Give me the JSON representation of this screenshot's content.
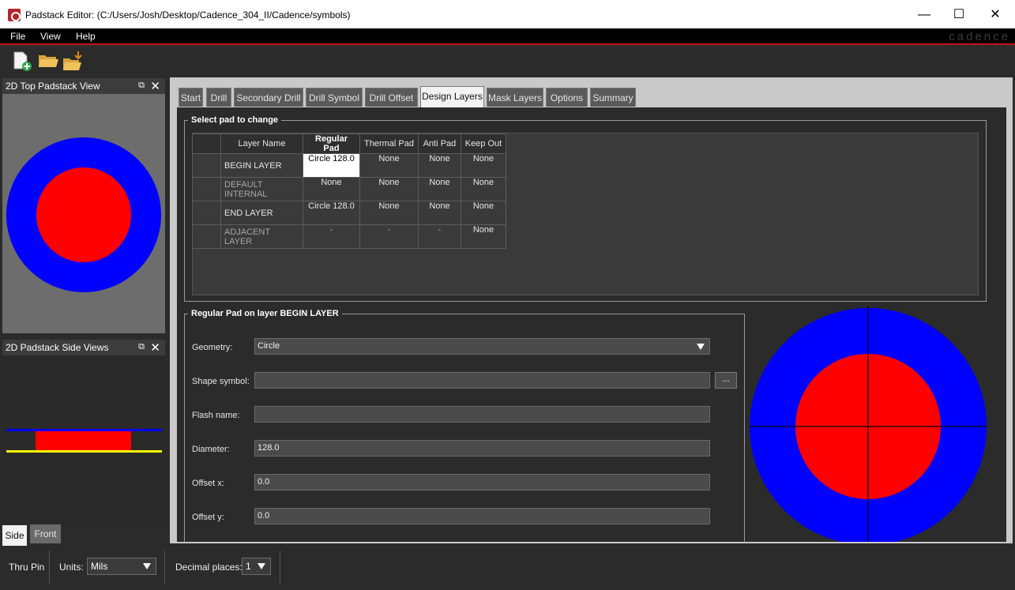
{
  "window": {
    "title": "Padstack Editor:  (C:/Users/Josh/Desktop/Cadence_304_II/Cadence/symbols)",
    "minimize": "—",
    "maximize": "☐",
    "close": "✕"
  },
  "menu": {
    "file": "File",
    "view": "View",
    "help": "Help",
    "brand": "cadence"
  },
  "toolbar": {
    "icons": [
      "new-file-icon",
      "open-folder-icon",
      "open-folder-download-icon"
    ]
  },
  "panels": {
    "top_view": {
      "title": "2D Top Padstack View"
    },
    "side_view": {
      "title": "2D Padstack Side Views",
      "tabs": [
        "Side",
        "Front"
      ]
    }
  },
  "tabs": [
    "Start",
    "Drill",
    "Secondary Drill",
    "Drill Symbol",
    "Drill Offset",
    "Design Layers",
    "Mask Layers",
    "Options",
    "Summary"
  ],
  "active_tab": "Design Layers",
  "select_pad": {
    "group_label": "Select pad to change",
    "columns": [
      "Layer Name",
      "Regular Pad",
      "Thermal Pad",
      "Anti Pad",
      "Keep Out"
    ],
    "rows": [
      {
        "layer": "BEGIN LAYER",
        "regular": "Circle 128.0",
        "thermal": "None",
        "anti": "None",
        "keepout": "None"
      },
      {
        "layer": "DEFAULT INTERNAL",
        "regular": "None",
        "thermal": "None",
        "anti": "None",
        "keepout": "None"
      },
      {
        "layer": "END LAYER",
        "regular": "Circle 128.0",
        "thermal": "None",
        "anti": "None",
        "keepout": "None"
      },
      {
        "layer": "ADJACENT LAYER",
        "regular": "-",
        "thermal": "-",
        "anti": "-",
        "keepout": "None"
      }
    ]
  },
  "pad_details": {
    "group_label": "Regular Pad on layer BEGIN LAYER",
    "geometry_label": "Geometry:",
    "geometry_value": "Circle",
    "shape_symbol_label": "Shape symbol:",
    "shape_symbol_value": "",
    "browse_button": "...",
    "flash_name_label": "Flash name:",
    "flash_name_value": "",
    "diameter_label": "Diameter:",
    "diameter_value": "128.0",
    "offset_x_label": "Offset x:",
    "offset_x_value": "0.0",
    "offset_y_label": "Offset y:",
    "offset_y_value": "0.0"
  },
  "status": {
    "type": "Thru Pin",
    "units_label": "Units:",
    "units_value": "Mils",
    "decimal_label": "Decimal places:",
    "decimal_value": "1"
  },
  "colors": {
    "pad_outer": "#0000ff",
    "pad_inner": "#ff0000",
    "side_line_top": "#0000ff",
    "side_line_bottom": "#ffff00",
    "menu_accent": "#c0141c"
  }
}
